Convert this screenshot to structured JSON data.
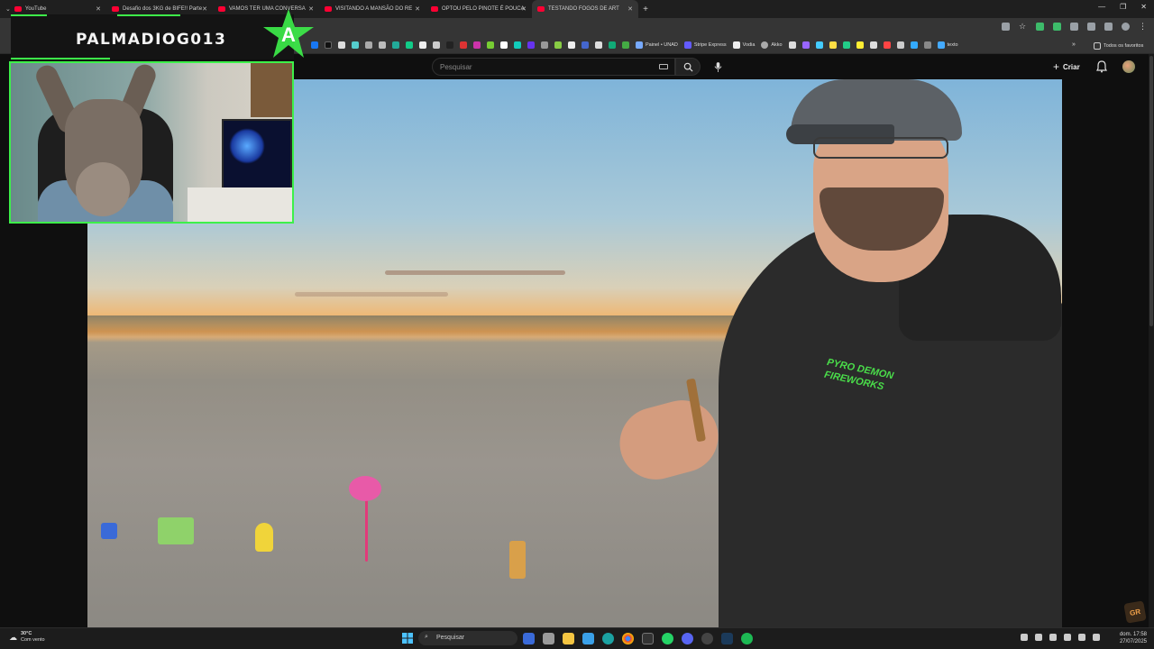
{
  "browser": {
    "tabs": [
      {
        "label": "YouTube",
        "active": false
      },
      {
        "label": "Desafio dos 3KG de BIFE!! Parte",
        "active": false
      },
      {
        "label": "VAMOS TER UMA CONVERSA",
        "active": false
      },
      {
        "label": "VISITANDO A MANSÃO DO RE",
        "active": false
      },
      {
        "label": "OPTOU PELO PINOTE É POUCA",
        "active": false
      },
      {
        "label": "TESTANDO FOGOS DE ART",
        "active": true
      }
    ],
    "bookmarks": [
      "Painel • UNAD",
      "Stripe Express",
      "Vodia",
      "Akko",
      "texto"
    ],
    "all_bookmarks_label": "Todos os favoritos"
  },
  "youtube": {
    "search_placeholder": "Pesquisar",
    "create_label": "Criar"
  },
  "stream_overlay": {
    "channel_name": "PALMADIOG013",
    "logo_letter": "A"
  },
  "video": {
    "hoodie_text": "PYRO DEMON FIREWORKS"
  },
  "taskbar": {
    "weather_temp": "30°C",
    "weather_desc": "Com vento",
    "search_label": "Pesquisar",
    "time": "17:58",
    "day": "dom.",
    "date": "27/07/2025"
  },
  "colors": {
    "accent_green": "#3df04a",
    "yt_red": "#ff0033"
  }
}
